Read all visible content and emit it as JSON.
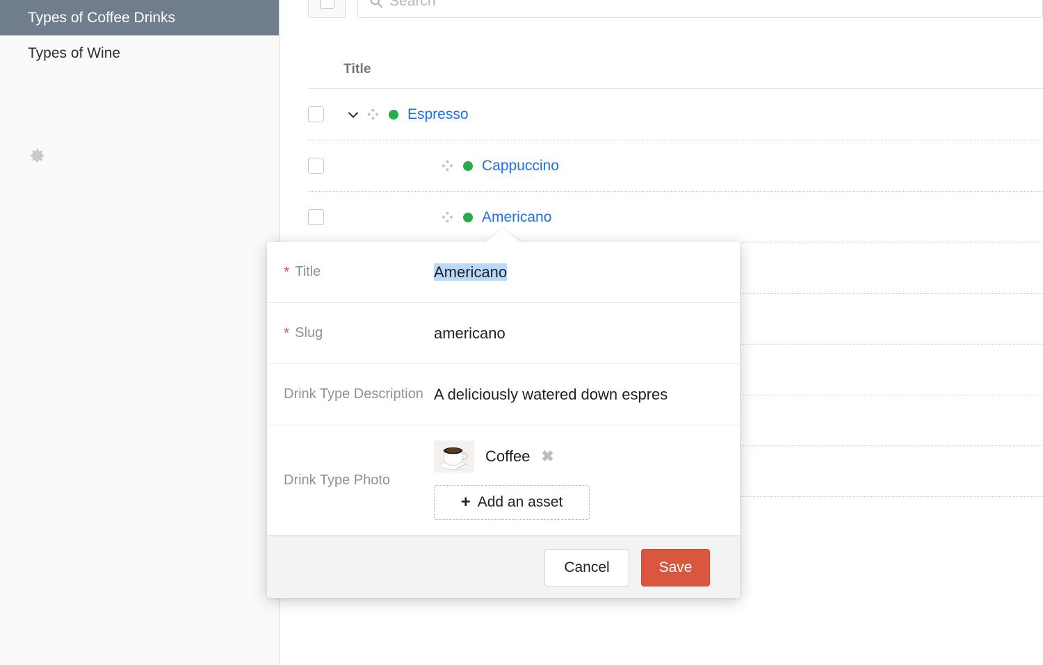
{
  "sidebar": {
    "items": [
      {
        "label": "Types of Coffee Drinks",
        "active": true
      },
      {
        "label": "Types of Wine",
        "active": false
      }
    ],
    "settings_icon": "gear-icon"
  },
  "toolbar": {
    "select_all_checkbox": "",
    "search_icon": "search-icon",
    "search_placeholder": "Search",
    "search_value": ""
  },
  "table": {
    "columns": [
      "Title"
    ],
    "rows": [
      {
        "title": "Espresso",
        "status": "live",
        "indent": 0,
        "expanded": true,
        "has_chevron": true
      },
      {
        "title": "Cappuccino",
        "status": "live",
        "indent": 1,
        "expanded": false,
        "has_chevron": false
      },
      {
        "title": "Americano",
        "status": "live",
        "indent": 1,
        "expanded": false,
        "has_chevron": false
      }
    ],
    "empty_row_count": 5,
    "status_color": "#27ab4b",
    "link_color": "#1f6fe5"
  },
  "modal": {
    "fields": [
      {
        "label": "Title",
        "required": true,
        "value": "Americano",
        "selected": true
      },
      {
        "label": "Slug",
        "required": true,
        "value": "americano",
        "selected": false
      },
      {
        "label": "Drink Type Description",
        "required": false,
        "value": "A deliciously watered down espres",
        "selected": false
      }
    ],
    "photo_field": {
      "label": "Drink Type Photo",
      "asset_name": "Coffee",
      "asset_thumb": "coffee-cup-photo",
      "remove_label": "✖",
      "add_label": "Add an asset",
      "add_plus": "+"
    },
    "footer": {
      "cancel_label": "Cancel",
      "save_label": "Save"
    }
  },
  "colors": {
    "sidebar_active_bg": "#6f7d8c",
    "save_button": "#d9573f",
    "required_star": "#d05a45",
    "selection_highlight": "#b9d9fb",
    "link": "#1f6fe5",
    "status_green": "#27ab4b"
  }
}
